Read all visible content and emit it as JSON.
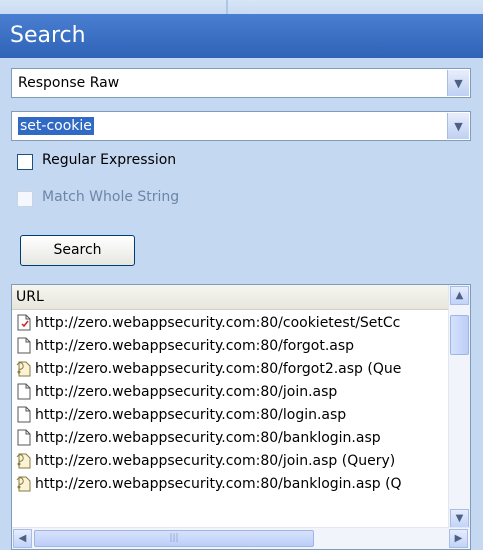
{
  "panel": {
    "title": "Search"
  },
  "fields": {
    "search_in": "Response Raw",
    "search_term": "set-cookie"
  },
  "options": {
    "regex_label": "Regular Expression",
    "regex_checked": false,
    "match_whole_label": "Match Whole String",
    "match_whole_checked": false,
    "match_whole_enabled": false
  },
  "search_button_label": "Search",
  "results": {
    "column_header": "URL",
    "rows": [
      {
        "url": "http://zero.webappsecurity.com:80/cookietest/SetCc",
        "icon": "page-cookie-icon"
      },
      {
        "url": "http://zero.webappsecurity.com:80/forgot.asp",
        "icon": "page-icon"
      },
      {
        "url": "http://zero.webappsecurity.com:80/forgot2.asp (Que",
        "icon": "query-page-icon"
      },
      {
        "url": "http://zero.webappsecurity.com:80/join.asp",
        "icon": "page-icon"
      },
      {
        "url": "http://zero.webappsecurity.com:80/login.asp",
        "icon": "page-icon"
      },
      {
        "url": "http://zero.webappsecurity.com:80/banklogin.asp",
        "icon": "page-icon"
      },
      {
        "url": "http://zero.webappsecurity.com:80/join.asp (Query)",
        "icon": "query-page-icon"
      },
      {
        "url": "http://zero.webappsecurity.com:80/banklogin.asp (Q",
        "icon": "query-page-icon"
      }
    ]
  }
}
